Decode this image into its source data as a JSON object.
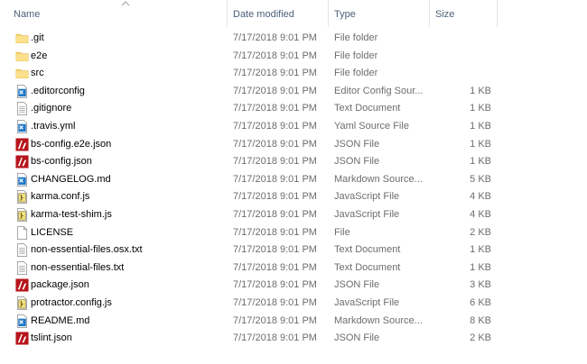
{
  "columns": {
    "name": "Name",
    "date": "Date modified",
    "type": "Type",
    "size": "Size"
  },
  "sort": {
    "column": "name",
    "direction": "ascending"
  },
  "colors": {
    "header_text": "#4c607a",
    "folder": "#f8d775",
    "meta_text": "#6d6d6d"
  },
  "files": [
    {
      "name": ".git",
      "date": "7/17/2018 9:01 PM",
      "type": "File folder",
      "size": "",
      "icon": "folder-icon"
    },
    {
      "name": "e2e",
      "date": "7/17/2018 9:01 PM",
      "type": "File folder",
      "size": "",
      "icon": "folder-icon"
    },
    {
      "name": "src",
      "date": "7/17/2018 9:01 PM",
      "type": "File folder",
      "size": "",
      "icon": "folder-icon"
    },
    {
      "name": ".editorconfig",
      "date": "7/17/2018 9:01 PM",
      "type": "Editor Config Sour...",
      "size": "1 KB",
      "icon": "vscode-file-icon"
    },
    {
      "name": ".gitignore",
      "date": "7/17/2018 9:01 PM",
      "type": "Text Document",
      "size": "1 KB",
      "icon": "text-file-icon"
    },
    {
      "name": ".travis.yml",
      "date": "7/17/2018 9:01 PM",
      "type": "Yaml Source File",
      "size": "1 KB",
      "icon": "vscode-file-icon"
    },
    {
      "name": "bs-config.e2e.json",
      "date": "7/17/2018 9:01 PM",
      "type": "JSON File",
      "size": "1 KB",
      "icon": "json-file-icon"
    },
    {
      "name": "bs-config.json",
      "date": "7/17/2018 9:01 PM",
      "type": "JSON File",
      "size": "1 KB",
      "icon": "json-file-icon"
    },
    {
      "name": "CHANGELOG.md",
      "date": "7/17/2018 9:01 PM",
      "type": "Markdown Source...",
      "size": "5 KB",
      "icon": "vscode-file-icon"
    },
    {
      "name": "karma.conf.js",
      "date": "7/17/2018 9:01 PM",
      "type": "JavaScript File",
      "size": "4 KB",
      "icon": "script-file-icon"
    },
    {
      "name": "karma-test-shim.js",
      "date": "7/17/2018 9:01 PM",
      "type": "JavaScript File",
      "size": "4 KB",
      "icon": "script-file-icon"
    },
    {
      "name": "LICENSE",
      "date": "7/17/2018 9:01 PM",
      "type": "File",
      "size": "2 KB",
      "icon": "blank-file-icon"
    },
    {
      "name": "non-essential-files.osx.txt",
      "date": "7/17/2018 9:01 PM",
      "type": "Text Document",
      "size": "1 KB",
      "icon": "text-file-icon"
    },
    {
      "name": "non-essential-files.txt",
      "date": "7/17/2018 9:01 PM",
      "type": "Text Document",
      "size": "1 KB",
      "icon": "text-file-icon"
    },
    {
      "name": "package.json",
      "date": "7/17/2018 9:01 PM",
      "type": "JSON File",
      "size": "3 KB",
      "icon": "json-file-icon"
    },
    {
      "name": "protractor.config.js",
      "date": "7/17/2018 9:01 PM",
      "type": "JavaScript File",
      "size": "6 KB",
      "icon": "script-file-icon"
    },
    {
      "name": "README.md",
      "date": "7/17/2018 9:01 PM",
      "type": "Markdown Source...",
      "size": "8 KB",
      "icon": "vscode-file-icon"
    },
    {
      "name": "tslint.json",
      "date": "7/17/2018 9:01 PM",
      "type": "JSON File",
      "size": "2 KB",
      "icon": "json-file-icon"
    }
  ]
}
